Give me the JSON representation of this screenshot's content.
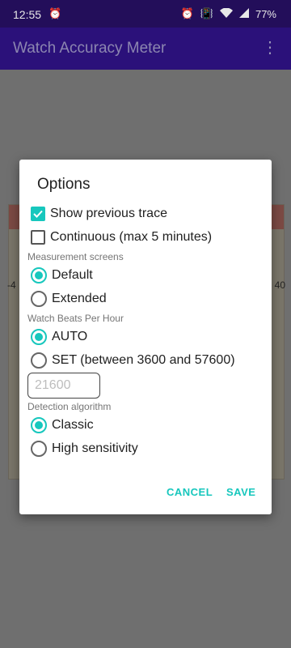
{
  "status_bar": {
    "time": "12:55",
    "battery": "77%",
    "icons": [
      "alarm-icon",
      "alarm-icon",
      "vibrate-icon",
      "wifi-icon",
      "signal-icon",
      "battery-icon"
    ]
  },
  "app_bar": {
    "title": "Watch Accuracy Meter",
    "menu_icon": "more-vert-icon"
  },
  "background_chart": {
    "left_tick": "-4",
    "right_tick": "40"
  },
  "dialog": {
    "title": "Options",
    "show_previous_trace": {
      "label": "Show previous trace",
      "checked": true
    },
    "continuous": {
      "label": "Continuous (max 5 minutes)",
      "checked": false
    },
    "measurement_screens": {
      "header": "Measurement screens",
      "options": [
        {
          "label": "Default",
          "selected": true
        },
        {
          "label": "Extended",
          "selected": false
        }
      ]
    },
    "beats_per_hour": {
      "header": "Watch Beats Per Hour",
      "options": [
        {
          "label": "AUTO",
          "selected": true
        },
        {
          "label": "SET (between 3600 and 57600)",
          "selected": false
        }
      ],
      "input_placeholder": "21600",
      "input_value": ""
    },
    "detection_algorithm": {
      "header": "Detection algorithm",
      "options": [
        {
          "label": "Classic",
          "selected": true
        },
        {
          "label": "High sensitivity",
          "selected": false
        }
      ]
    },
    "buttons": {
      "cancel": "CANCEL",
      "save": "SAVE"
    }
  },
  "colors": {
    "accent": "#17c7bd",
    "app_bar": "#2b117a",
    "status_bar": "#230e5a"
  }
}
